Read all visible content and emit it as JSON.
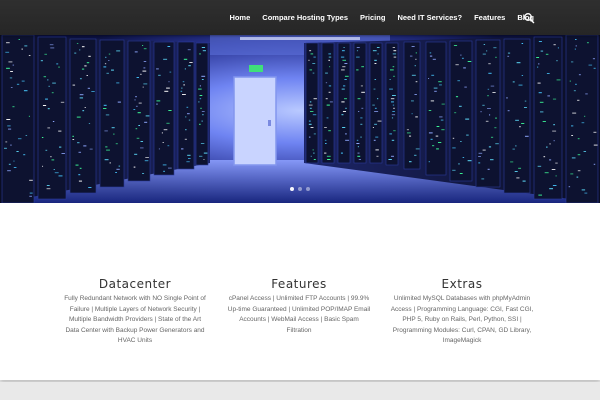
{
  "nav": {
    "items": [
      "Home",
      "Compare Hosting Types",
      "Pricing",
      "Need IT Services?",
      "Features",
      "Blog"
    ],
    "search_icon": "search-icon"
  },
  "hero": {
    "image": "datacenter server room with glowing blue server racks and a door at the end of the aisle",
    "slides": 3,
    "active_slide": 1
  },
  "features": [
    {
      "title": "Datacenter",
      "text": "Fully Redundant Network with NO Single Point of Failure | Multiple Layers of Network Security | Multiple Bandwidth Providers | State of the Art Data Center with Backup Power Generators and HVAC Units"
    },
    {
      "title": "Features",
      "text": "cPanel Access | Unlimited FTP Accounts | 99.9% Up-time Guaranteed | Unlimited POP/IMAP Email Accounts | WebMail Access | Basic Spam Filtration"
    },
    {
      "title": "Extras",
      "text": "Unlimited MySQL Databases with phpMyAdmin Access | Programming Language: CGI, Fast CGI, PHP 5, Ruby on Rails, Perl, Python, SSI | Programming Modules: Curl, CPAN, GD Library, ImageMagick"
    }
  ],
  "colors": {
    "header_bg": "#2a2a2a",
    "nav_text": "#ffffff",
    "title_text": "#333333",
    "body_text": "#666666"
  }
}
